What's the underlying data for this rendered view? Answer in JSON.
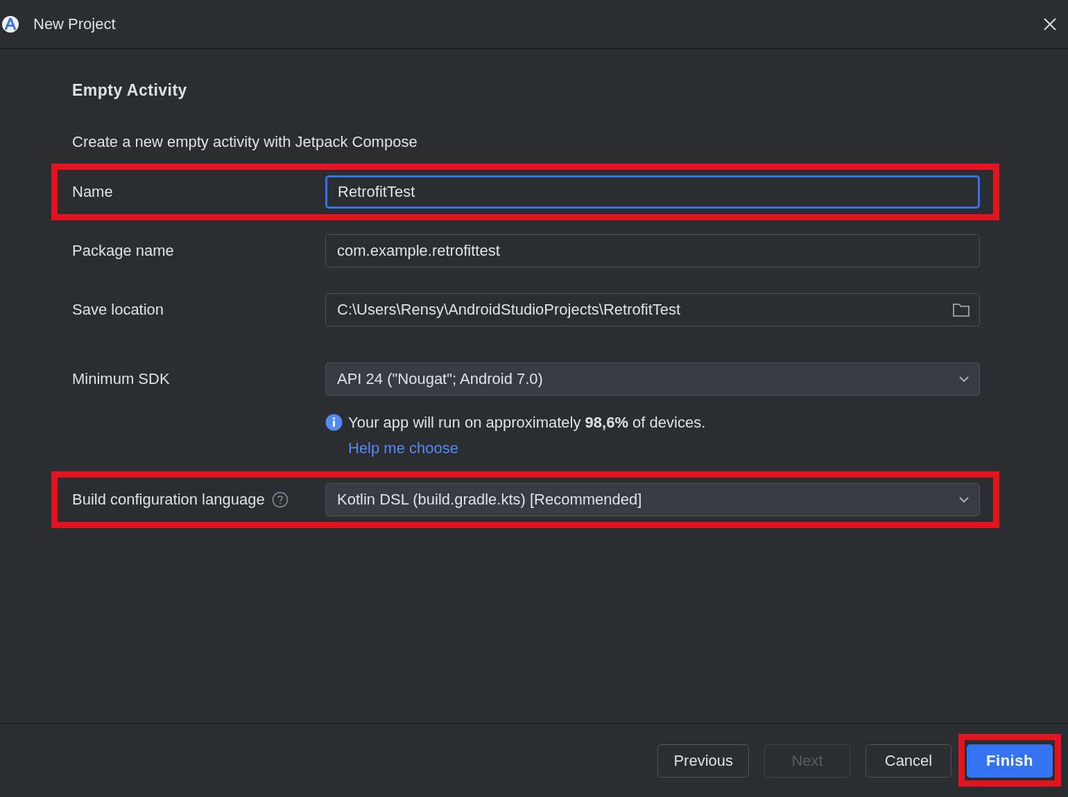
{
  "window": {
    "title": "New Project"
  },
  "heading": "Empty Activity",
  "description": "Create a new empty activity with Jetpack Compose",
  "fields": [
    {
      "kind": "text",
      "label": "Name",
      "value": "RetrofitTest",
      "focused": true,
      "highlighted": true
    },
    {
      "kind": "text",
      "label": "Package name",
      "value": "com.example.retrofittest",
      "focused": false,
      "highlighted": false
    },
    {
      "kind": "folder",
      "label": "Save location",
      "value": "C:\\Users\\Rensy\\AndroidStudioProjects\\RetrofitTest",
      "focused": false,
      "highlighted": false
    },
    {
      "kind": "dropdown",
      "label": "Minimum SDK",
      "value": "API 24 (\"Nougat\"; Android 7.0)",
      "focused": false,
      "highlighted": false,
      "note": {
        "text": "Your app will run on approximately **98,6%** of devices.",
        "link": "Help me choose"
      }
    },
    {
      "kind": "dropdown",
      "label": "Build configuration language",
      "value": "Kotlin DSL (build.gradle.kts) [Recommended]",
      "focused": false,
      "highlighted": true,
      "help": true
    }
  ],
  "buttons": [
    {
      "label": "Previous",
      "kind": "secondary",
      "disabled": false,
      "highlighted": false
    },
    {
      "label": "Next",
      "kind": "secondary",
      "disabled": true,
      "highlighted": false
    },
    {
      "label": "Cancel",
      "kind": "secondary",
      "disabled": false,
      "highlighted": false
    },
    {
      "label": "Finish",
      "kind": "primary",
      "disabled": false,
      "highlighted": true
    }
  ]
}
